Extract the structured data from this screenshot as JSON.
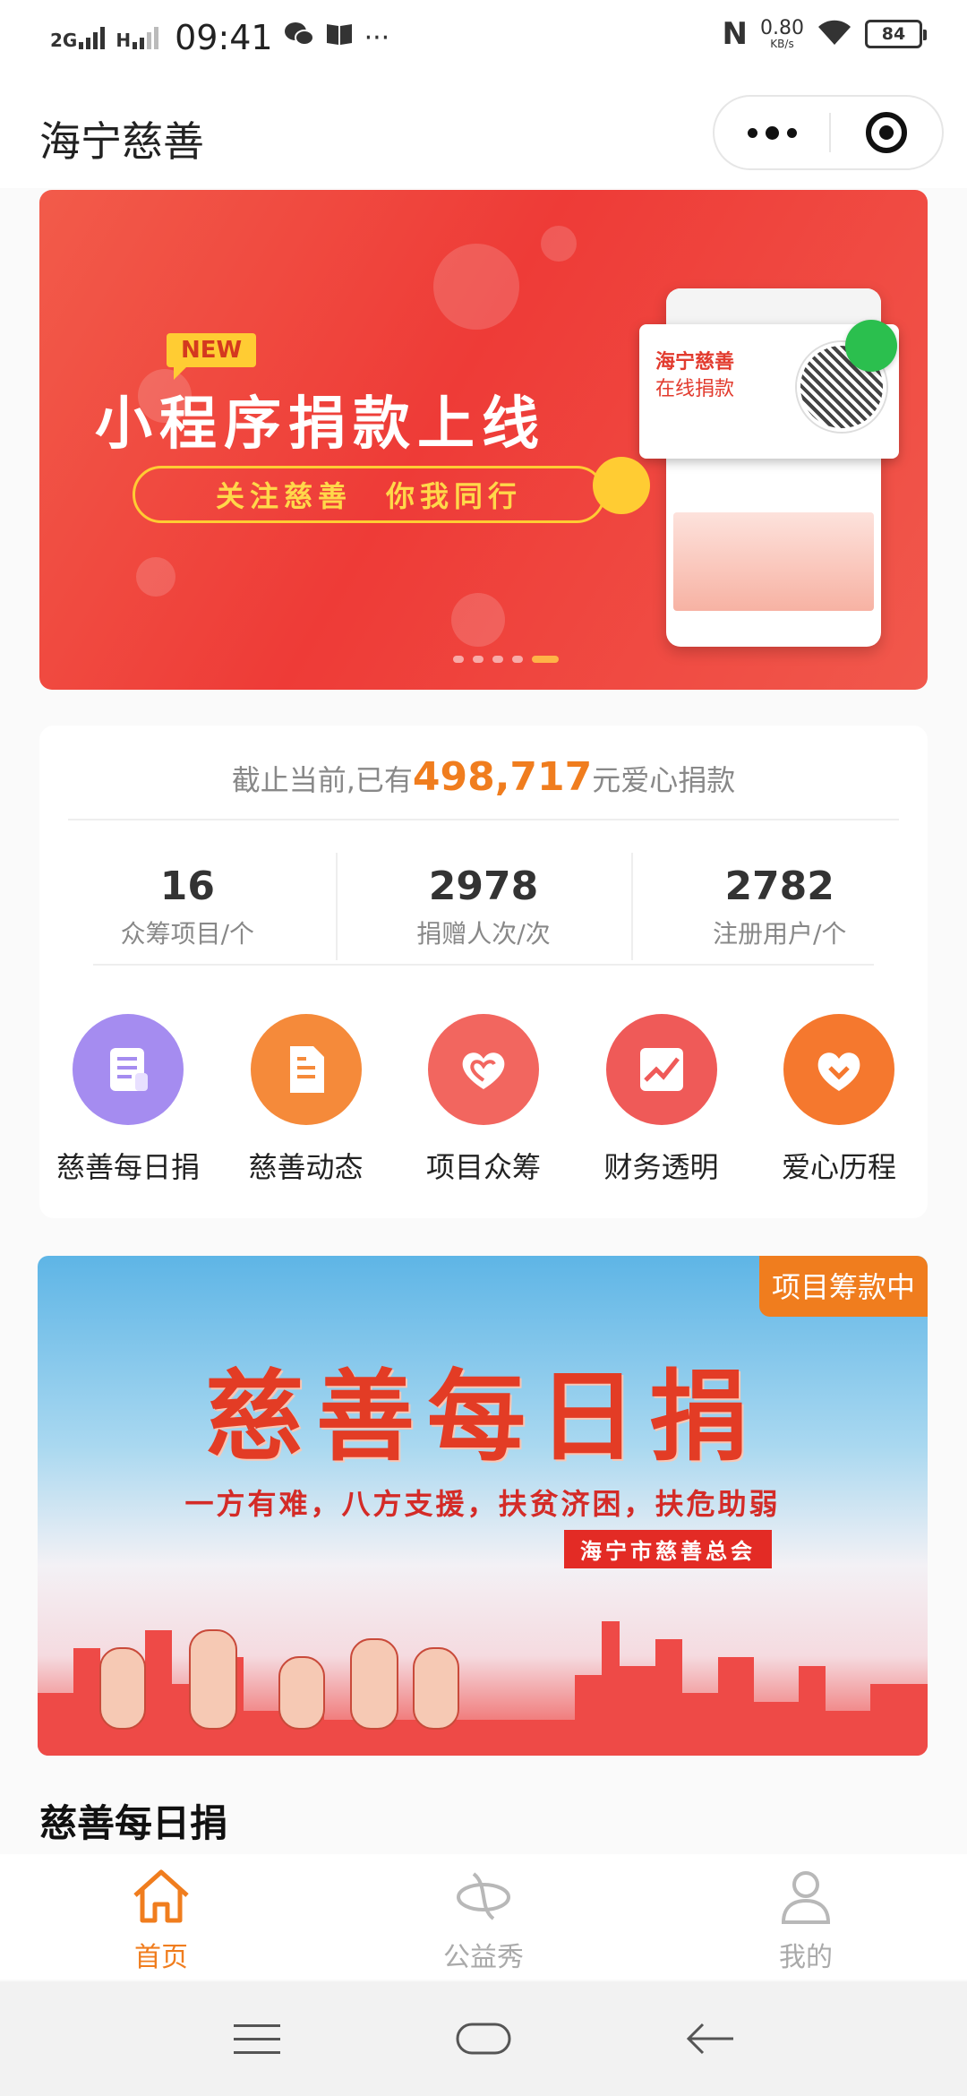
{
  "status_bar": {
    "network": "2G",
    "network2": "H",
    "time": "09:41",
    "more": "···",
    "nfc": "N",
    "speed_value": "0.80",
    "speed_unit": "KB/s",
    "battery": "84"
  },
  "navbar": {
    "title": "海宁慈善"
  },
  "banner": {
    "new_tag": "NEW",
    "headline": "小程序捐款上线",
    "pill": "关注慈善　你我同行",
    "card_text_1": "海宁慈善",
    "card_text_2": "在线捐款",
    "slide_count": 5,
    "active_slide": 5
  },
  "stats": {
    "prefix": "截止当前,已有",
    "amount": "498,717",
    "suffix": "元爱心捐款",
    "items": [
      {
        "value": "16",
        "label": "众筹项目/个"
      },
      {
        "value": "2978",
        "label": "捐赠人次/次"
      },
      {
        "value": "2782",
        "label": "注册用户/个"
      }
    ]
  },
  "menu": [
    {
      "label": "慈善每日捐",
      "icon": "document-icon",
      "color": "#a58cf0"
    },
    {
      "label": "慈善动态",
      "icon": "file-icon",
      "color": "#f58a3a"
    },
    {
      "label": "项目众筹",
      "icon": "heart-icon",
      "color": "#f2665f"
    },
    {
      "label": "财务透明",
      "icon": "trend-chart-icon",
      "color": "#ef5a58"
    },
    {
      "label": "爱心历程",
      "icon": "heart-check-icon",
      "color": "#f5782e"
    }
  ],
  "project": {
    "badge": "项目筹款中",
    "title": "慈善每日捐",
    "slogan": "一方有难，八方支援，扶贫济困，扶危助弱",
    "org": "海宁市慈善总会"
  },
  "section_title": "慈善每日捐",
  "tabs": [
    {
      "label": "首页",
      "icon": "home-icon",
      "active": true
    },
    {
      "label": "公益秀",
      "icon": "show-icon",
      "active": false
    },
    {
      "label": "我的",
      "icon": "user-icon",
      "active": false
    }
  ],
  "colors": {
    "accent": "#f07d1e",
    "banner_red": "#ee3b37"
  }
}
